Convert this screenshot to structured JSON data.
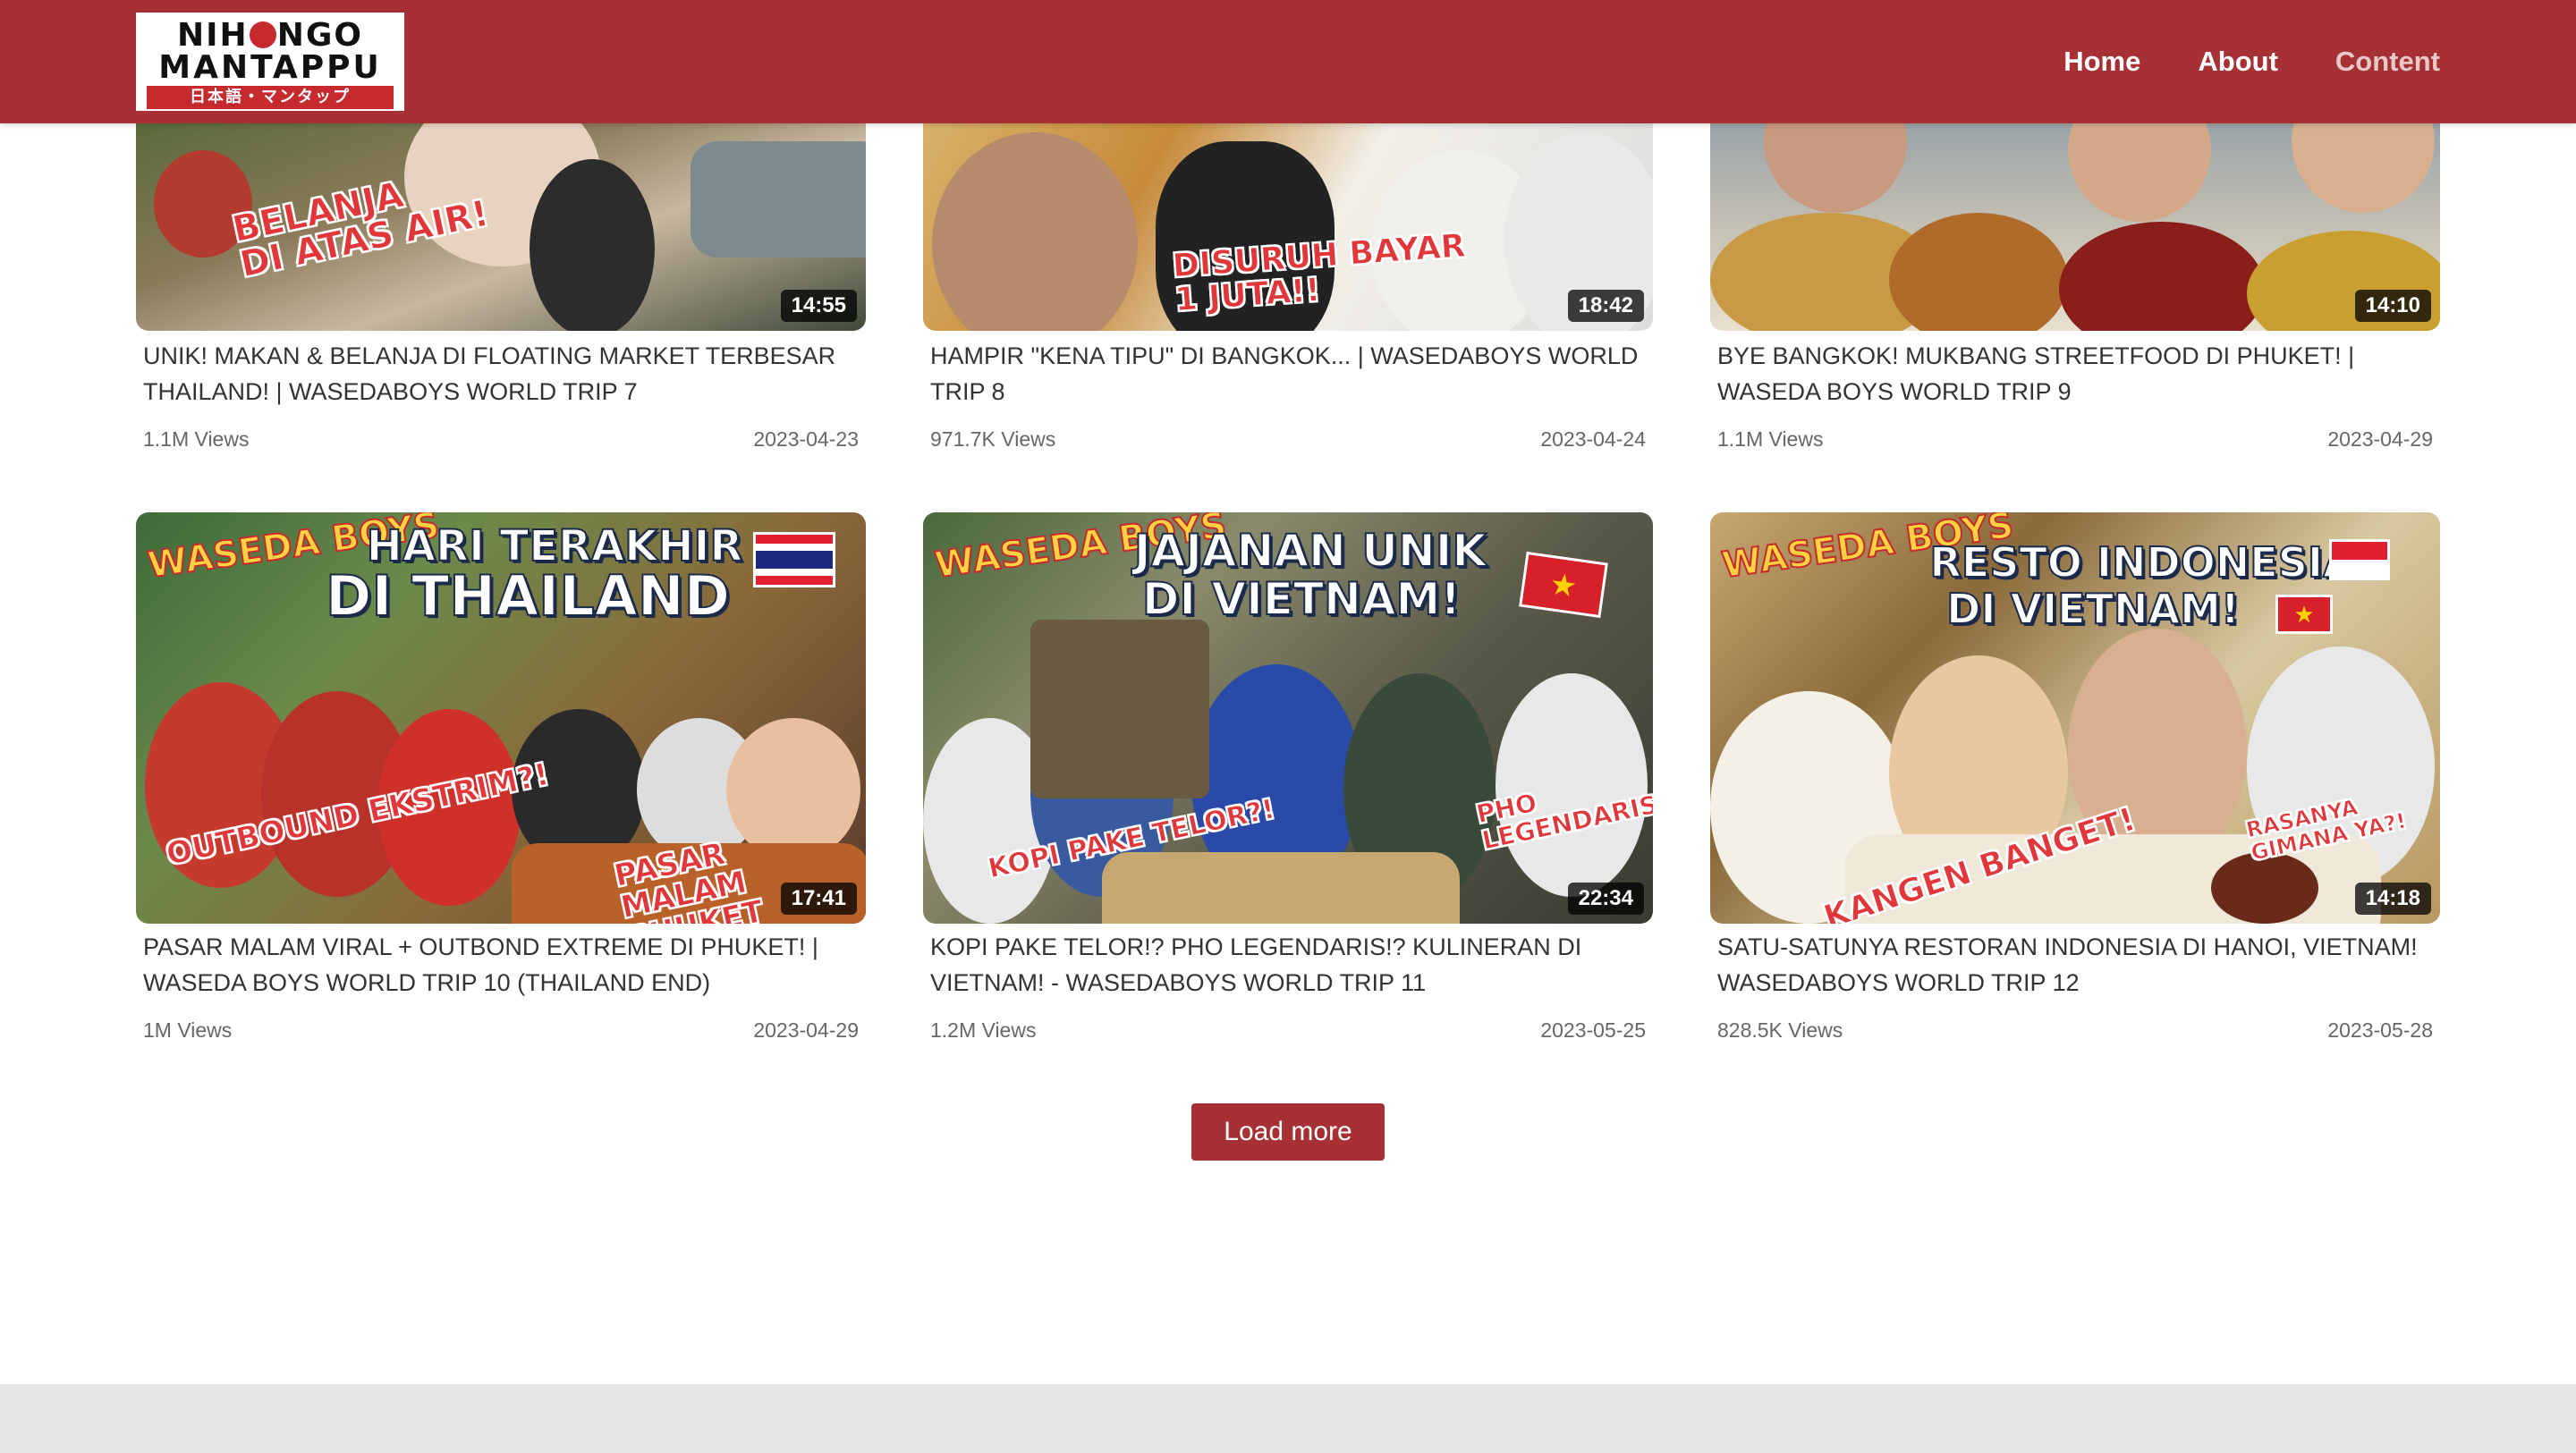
{
  "header": {
    "logo": {
      "line1": "NIHONGO",
      "line2": "MANTAPPU",
      "line3": "日本語・マンタップ"
    },
    "nav": [
      {
        "label": "Home"
      },
      {
        "label": "About"
      },
      {
        "label": "Content",
        "active": true
      }
    ],
    "colors": {
      "brand": "#a63034",
      "active_nav": "#e8c9ca"
    }
  },
  "videos": [
    {
      "title": "UNIK! MAKAN & BELANJA DI FLOATING MARKET TERBESAR THAILAND! | WASEDABOYS WORLD TRIP 7",
      "views": "1.1M Views",
      "date": "2023-04-23",
      "duration": "14:55",
      "thumb_text": [
        "BELANJA",
        "DI ATAS AIR!"
      ]
    },
    {
      "title": "HAMPIR \"KENA TIPU\" DI BANGKOK... | WASEDABOYS WORLD TRIP 8",
      "views": "971.7K Views",
      "date": "2023-04-24",
      "duration": "18:42",
      "thumb_text": [
        "DISURUH BAYAR",
        "1 JUTA!!"
      ]
    },
    {
      "title": "BYE BANGKOK! MUKBANG STREETFOOD DI PHUKET! | WASEDA BOYS WORLD TRIP 9",
      "views": "1.1M Views",
      "date": "2023-04-29",
      "duration": "14:10",
      "thumb_text": []
    },
    {
      "title": "PASAR MALAM VIRAL + OUTBOND EXTREME DI PHUKET! | WASEDA BOYS WORLD TRIP 10 (THAILAND END)",
      "views": "1M Views",
      "date": "2023-04-29",
      "duration": "17:41",
      "thumb_text": [
        "HARI TERAKHIR",
        "DI THAILAND",
        "OUTBOUND EKSTRIM?!",
        "PASAR MALAM PHUKET"
      ]
    },
    {
      "title": "KOPI PAKE TELOR!? PHO LEGENDARIS!? KULINERAN DI VIETNAM! - WASEDABOYS WORLD TRIP 11",
      "views": "1.2M Views",
      "date": "2023-05-25",
      "duration": "22:34",
      "thumb_text": [
        "JAJANAN UNIK",
        "DI VIETNAM!",
        "KOPI PAKE TELOR?!",
        "PHO LEGENDARIS!!"
      ]
    },
    {
      "title": "SATU-SATUNYA RESTORAN INDONESIA DI HANOI, VIETNAM! WASEDABOYS WORLD TRIP 12",
      "views": "828.5K Views",
      "date": "2023-05-28",
      "duration": "14:18",
      "thumb_text": [
        "RESTO INDONESIA",
        "DI VIETNAM!",
        "KANGEN BANGET!",
        "RASANYA GIMANA YA?!"
      ]
    }
  ],
  "thumb_badge": "WASEDA BOYS",
  "load_more_label": "Load more"
}
